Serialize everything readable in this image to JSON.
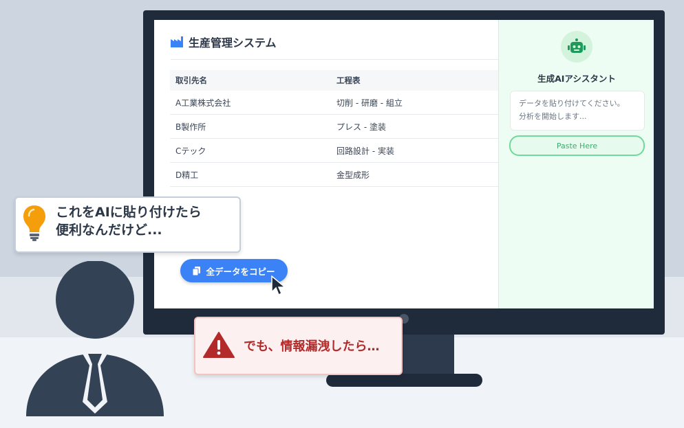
{
  "app": {
    "title": "生産管理システム",
    "table": {
      "headers": [
        "取引先名",
        "工程表"
      ],
      "rows": [
        [
          "A工業株式会社",
          "切削 - 研磨 - 組立"
        ],
        [
          "B製作所",
          "プレス - 塗装"
        ],
        [
          "Cテック",
          "回路設計 - 実装"
        ],
        [
          "D精工",
          "金型成形"
        ]
      ]
    },
    "copy_button_label": "全データをコピー"
  },
  "assistant": {
    "title": "生成AIアシスタント",
    "prompt_line1": "データを貼り付けてください。",
    "prompt_line2": "分析を開始します...",
    "paste_button_label": "Paste Here"
  },
  "thought_bubble": {
    "line1": "これをAIに貼り付けたら",
    "line2": "便利なんだけど..."
  },
  "warning_bubble": {
    "text": "でも、情報漏洩したら…"
  },
  "colors": {
    "accent_blue": "#3b82f6",
    "assistant_green": "#6fd99b",
    "warning_red": "#b22a2a",
    "bulb_orange": "#f59e0b",
    "dark_navy": "#2c3748"
  },
  "icons": [
    "factory-icon",
    "copy-icon",
    "mouse-cursor-icon",
    "robot-icon",
    "lightbulb-icon",
    "warning-icon",
    "person-icon"
  ]
}
